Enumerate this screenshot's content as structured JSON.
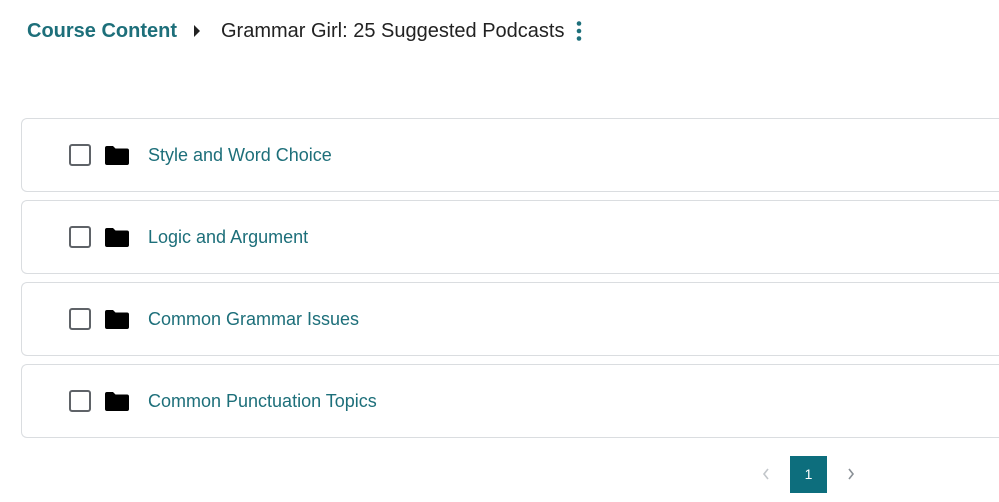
{
  "breadcrumb": {
    "parent_label": "Course Content",
    "current_label": "Grammar Girl: 25 Suggested Podcasts"
  },
  "colors": {
    "link": "#1d6f7a",
    "text": "#222222",
    "border": "#dadde0",
    "page_active_bg": "#0d6e7d"
  },
  "items": [
    {
      "label": "Style and Word Choice",
      "icon": "folder-icon",
      "checked": false
    },
    {
      "label": "Logic and Argument",
      "icon": "folder-icon",
      "checked": false
    },
    {
      "label": "Common Grammar Issues",
      "icon": "folder-icon",
      "checked": false
    },
    {
      "label": "Common Punctuation Topics",
      "icon": "folder-icon",
      "checked": false
    }
  ],
  "pagination": {
    "current_page": "1",
    "prev_icon": "chevron-left-icon",
    "next_icon": "chevron-right-icon"
  }
}
